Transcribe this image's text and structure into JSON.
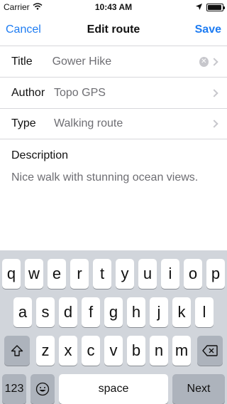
{
  "status_bar": {
    "carrier": "Carrier",
    "time": "10:43 AM",
    "battery_level": 0.95
  },
  "nav": {
    "cancel_label": "Cancel",
    "title": "Edit route",
    "save_label": "Save",
    "accent_color": "#1e7cf2"
  },
  "form": {
    "title_label": "Title",
    "title_value": "Gower Hike",
    "author_label": "Author",
    "author_value": "Topo GPS",
    "type_label": "Type",
    "type_value": "Walking route",
    "description_label": "Description",
    "description_value": "Nice walk with stunning ocean views."
  },
  "keyboard": {
    "row1": [
      "q",
      "w",
      "e",
      "r",
      "t",
      "y",
      "u",
      "i",
      "o",
      "p"
    ],
    "row2": [
      "a",
      "s",
      "d",
      "f",
      "g",
      "h",
      "j",
      "k",
      "l"
    ],
    "row3": [
      "z",
      "x",
      "c",
      "v",
      "b",
      "n",
      "m"
    ],
    "num_label": "123",
    "space_label": "space",
    "next_label": "Next",
    "icons": {
      "shift": "shift-icon",
      "backspace": "backspace-icon",
      "emoji": "emoji-icon"
    }
  }
}
